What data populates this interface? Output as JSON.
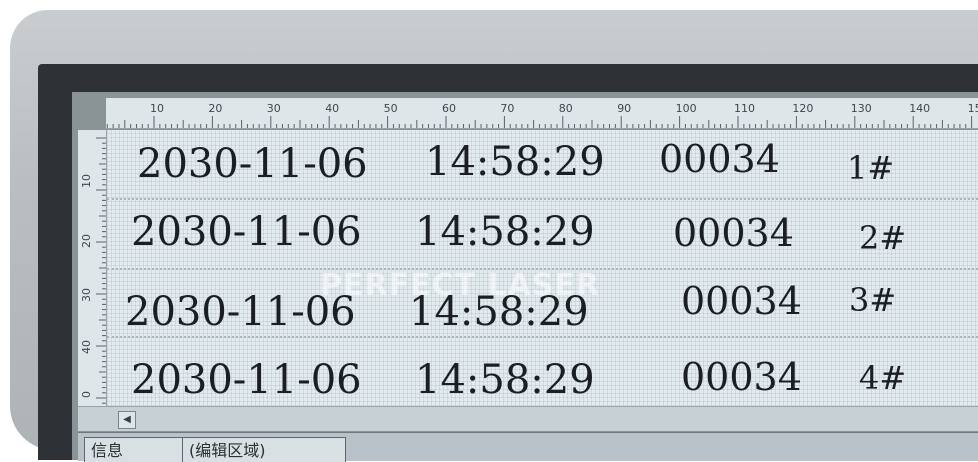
{
  "ruler": {
    "top_ticks": [
      "10",
      "20",
      "30",
      "40",
      "50",
      "60",
      "70",
      "80",
      "90",
      "100",
      "110",
      "120",
      "130",
      "140",
      "15"
    ],
    "left_ticks": [
      "10",
      "20",
      "30",
      "40",
      "0"
    ]
  },
  "rows": [
    {
      "date": "2030-11-06",
      "time": "14:58:29",
      "serial": "00034",
      "num": "1#"
    },
    {
      "date": "2030-11-06",
      "time": "14:58:29",
      "serial": "00034",
      "num": "2#"
    },
    {
      "date": "2030-11-06",
      "time": "14:58:29",
      "serial": "00034",
      "num": "3#"
    },
    {
      "date": "2030-11-06",
      "time": "14:58:29",
      "serial": "00034",
      "num": "4#"
    }
  ],
  "watermark": "PERFECT LASER",
  "scrollbar": {
    "left_arrow": "◀"
  },
  "bottom_tabs": [
    "信息",
    "(编辑区域)"
  ]
}
